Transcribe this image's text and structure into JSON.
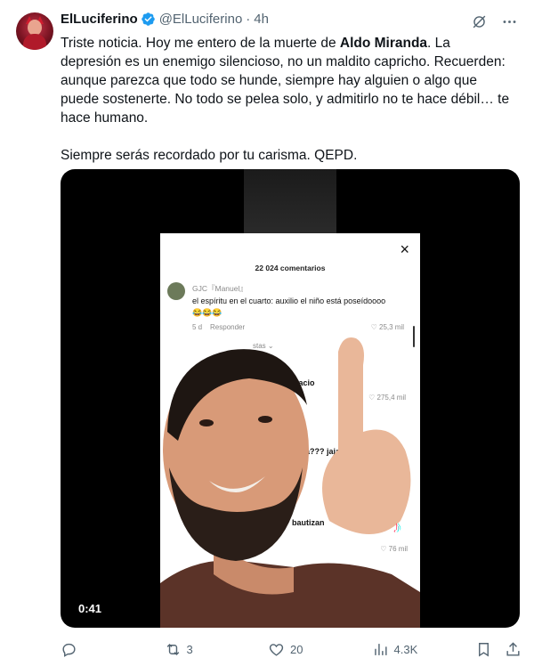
{
  "author": {
    "name": "ElLuciferino",
    "handle": "@ElLuciferino",
    "separator": "·",
    "time": "4h"
  },
  "tweet": {
    "line1_before": "Triste noticia. Hoy me entero de la muerte de ",
    "line1_bold": "Aldo Miranda",
    "line1_after": ". La depresión es un enemigo silencioso, no un maldito capricho. Recuerden: aunque parezca que todo se hunde, siempre hay alguien o algo que puede sostenerte. No todo se pelea solo, y admitirlo no te hace débil… te hace humano.",
    "line2": "Siempre serás recordado por tu carisma. QEPD."
  },
  "video": {
    "close_glyph": "×",
    "comment_count": "22 024 comentarios",
    "comment_user": "GJC『Manuel』",
    "comment_text": "el espíritu en el cuarto: auxilio el niño está poseídoooo 😂😂😂",
    "comment_age": "5 d",
    "comment_reply": "Responder",
    "like1": "♡ 25,3 mil",
    "frag_stas": "stas ⌄",
    "frag_vocacio": "vocacio",
    "like2": "♡ 275,4 mil",
    "frag_dia": "l día??? jaja",
    "frag_bautizan": "bautizan",
    "like3": "♡ 76 mil",
    "tk_k": "k",
    "duration": "0:41"
  },
  "actions": {
    "reposts": "3",
    "likes": "20",
    "views": "4.3K"
  },
  "colors": {
    "muted": "#536471",
    "verified": "#1d9bf0"
  }
}
